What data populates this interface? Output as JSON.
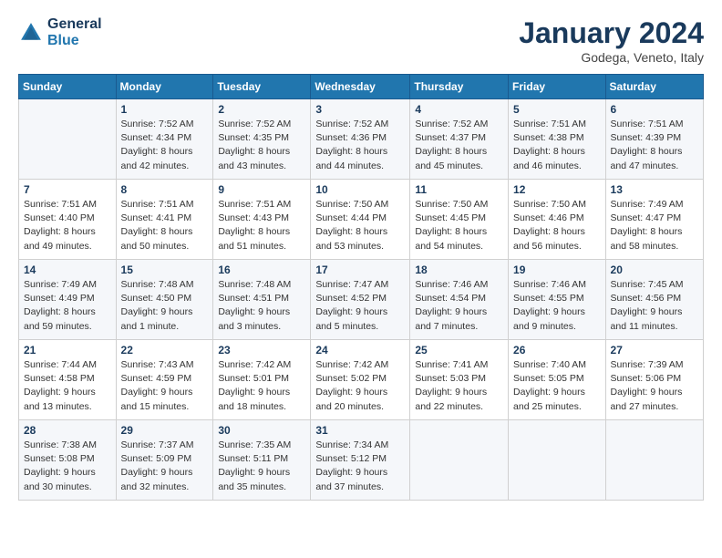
{
  "logo": {
    "line1": "General",
    "line2": "Blue"
  },
  "header": {
    "month": "January 2024",
    "location": "Godega, Veneto, Italy"
  },
  "weekdays": [
    "Sunday",
    "Monday",
    "Tuesday",
    "Wednesday",
    "Thursday",
    "Friday",
    "Saturday"
  ],
  "weeks": [
    [
      {
        "day": "",
        "sunrise": "",
        "sunset": "",
        "daylight": ""
      },
      {
        "day": "1",
        "sunrise": "Sunrise: 7:52 AM",
        "sunset": "Sunset: 4:34 PM",
        "daylight": "Daylight: 8 hours and 42 minutes."
      },
      {
        "day": "2",
        "sunrise": "Sunrise: 7:52 AM",
        "sunset": "Sunset: 4:35 PM",
        "daylight": "Daylight: 8 hours and 43 minutes."
      },
      {
        "day": "3",
        "sunrise": "Sunrise: 7:52 AM",
        "sunset": "Sunset: 4:36 PM",
        "daylight": "Daylight: 8 hours and 44 minutes."
      },
      {
        "day": "4",
        "sunrise": "Sunrise: 7:52 AM",
        "sunset": "Sunset: 4:37 PM",
        "daylight": "Daylight: 8 hours and 45 minutes."
      },
      {
        "day": "5",
        "sunrise": "Sunrise: 7:51 AM",
        "sunset": "Sunset: 4:38 PM",
        "daylight": "Daylight: 8 hours and 46 minutes."
      },
      {
        "day": "6",
        "sunrise": "Sunrise: 7:51 AM",
        "sunset": "Sunset: 4:39 PM",
        "daylight": "Daylight: 8 hours and 47 minutes."
      }
    ],
    [
      {
        "day": "7",
        "sunrise": "Sunrise: 7:51 AM",
        "sunset": "Sunset: 4:40 PM",
        "daylight": "Daylight: 8 hours and 49 minutes."
      },
      {
        "day": "8",
        "sunrise": "Sunrise: 7:51 AM",
        "sunset": "Sunset: 4:41 PM",
        "daylight": "Daylight: 8 hours and 50 minutes."
      },
      {
        "day": "9",
        "sunrise": "Sunrise: 7:51 AM",
        "sunset": "Sunset: 4:43 PM",
        "daylight": "Daylight: 8 hours and 51 minutes."
      },
      {
        "day": "10",
        "sunrise": "Sunrise: 7:50 AM",
        "sunset": "Sunset: 4:44 PM",
        "daylight": "Daylight: 8 hours and 53 minutes."
      },
      {
        "day": "11",
        "sunrise": "Sunrise: 7:50 AM",
        "sunset": "Sunset: 4:45 PM",
        "daylight": "Daylight: 8 hours and 54 minutes."
      },
      {
        "day": "12",
        "sunrise": "Sunrise: 7:50 AM",
        "sunset": "Sunset: 4:46 PM",
        "daylight": "Daylight: 8 hours and 56 minutes."
      },
      {
        "day": "13",
        "sunrise": "Sunrise: 7:49 AM",
        "sunset": "Sunset: 4:47 PM",
        "daylight": "Daylight: 8 hours and 58 minutes."
      }
    ],
    [
      {
        "day": "14",
        "sunrise": "Sunrise: 7:49 AM",
        "sunset": "Sunset: 4:49 PM",
        "daylight": "Daylight: 8 hours and 59 minutes."
      },
      {
        "day": "15",
        "sunrise": "Sunrise: 7:48 AM",
        "sunset": "Sunset: 4:50 PM",
        "daylight": "Daylight: 9 hours and 1 minute."
      },
      {
        "day": "16",
        "sunrise": "Sunrise: 7:48 AM",
        "sunset": "Sunset: 4:51 PM",
        "daylight": "Daylight: 9 hours and 3 minutes."
      },
      {
        "day": "17",
        "sunrise": "Sunrise: 7:47 AM",
        "sunset": "Sunset: 4:52 PM",
        "daylight": "Daylight: 9 hours and 5 minutes."
      },
      {
        "day": "18",
        "sunrise": "Sunrise: 7:46 AM",
        "sunset": "Sunset: 4:54 PM",
        "daylight": "Daylight: 9 hours and 7 minutes."
      },
      {
        "day": "19",
        "sunrise": "Sunrise: 7:46 AM",
        "sunset": "Sunset: 4:55 PM",
        "daylight": "Daylight: 9 hours and 9 minutes."
      },
      {
        "day": "20",
        "sunrise": "Sunrise: 7:45 AM",
        "sunset": "Sunset: 4:56 PM",
        "daylight": "Daylight: 9 hours and 11 minutes."
      }
    ],
    [
      {
        "day": "21",
        "sunrise": "Sunrise: 7:44 AM",
        "sunset": "Sunset: 4:58 PM",
        "daylight": "Daylight: 9 hours and 13 minutes."
      },
      {
        "day": "22",
        "sunrise": "Sunrise: 7:43 AM",
        "sunset": "Sunset: 4:59 PM",
        "daylight": "Daylight: 9 hours and 15 minutes."
      },
      {
        "day": "23",
        "sunrise": "Sunrise: 7:42 AM",
        "sunset": "Sunset: 5:01 PM",
        "daylight": "Daylight: 9 hours and 18 minutes."
      },
      {
        "day": "24",
        "sunrise": "Sunrise: 7:42 AM",
        "sunset": "Sunset: 5:02 PM",
        "daylight": "Daylight: 9 hours and 20 minutes."
      },
      {
        "day": "25",
        "sunrise": "Sunrise: 7:41 AM",
        "sunset": "Sunset: 5:03 PM",
        "daylight": "Daylight: 9 hours and 22 minutes."
      },
      {
        "day": "26",
        "sunrise": "Sunrise: 7:40 AM",
        "sunset": "Sunset: 5:05 PM",
        "daylight": "Daylight: 9 hours and 25 minutes."
      },
      {
        "day": "27",
        "sunrise": "Sunrise: 7:39 AM",
        "sunset": "Sunset: 5:06 PM",
        "daylight": "Daylight: 9 hours and 27 minutes."
      }
    ],
    [
      {
        "day": "28",
        "sunrise": "Sunrise: 7:38 AM",
        "sunset": "Sunset: 5:08 PM",
        "daylight": "Daylight: 9 hours and 30 minutes."
      },
      {
        "day": "29",
        "sunrise": "Sunrise: 7:37 AM",
        "sunset": "Sunset: 5:09 PM",
        "daylight": "Daylight: 9 hours and 32 minutes."
      },
      {
        "day": "30",
        "sunrise": "Sunrise: 7:35 AM",
        "sunset": "Sunset: 5:11 PM",
        "daylight": "Daylight: 9 hours and 35 minutes."
      },
      {
        "day": "31",
        "sunrise": "Sunrise: 7:34 AM",
        "sunset": "Sunset: 5:12 PM",
        "daylight": "Daylight: 9 hours and 37 minutes."
      },
      {
        "day": "",
        "sunrise": "",
        "sunset": "",
        "daylight": ""
      },
      {
        "day": "",
        "sunrise": "",
        "sunset": "",
        "daylight": ""
      },
      {
        "day": "",
        "sunrise": "",
        "sunset": "",
        "daylight": ""
      }
    ]
  ]
}
